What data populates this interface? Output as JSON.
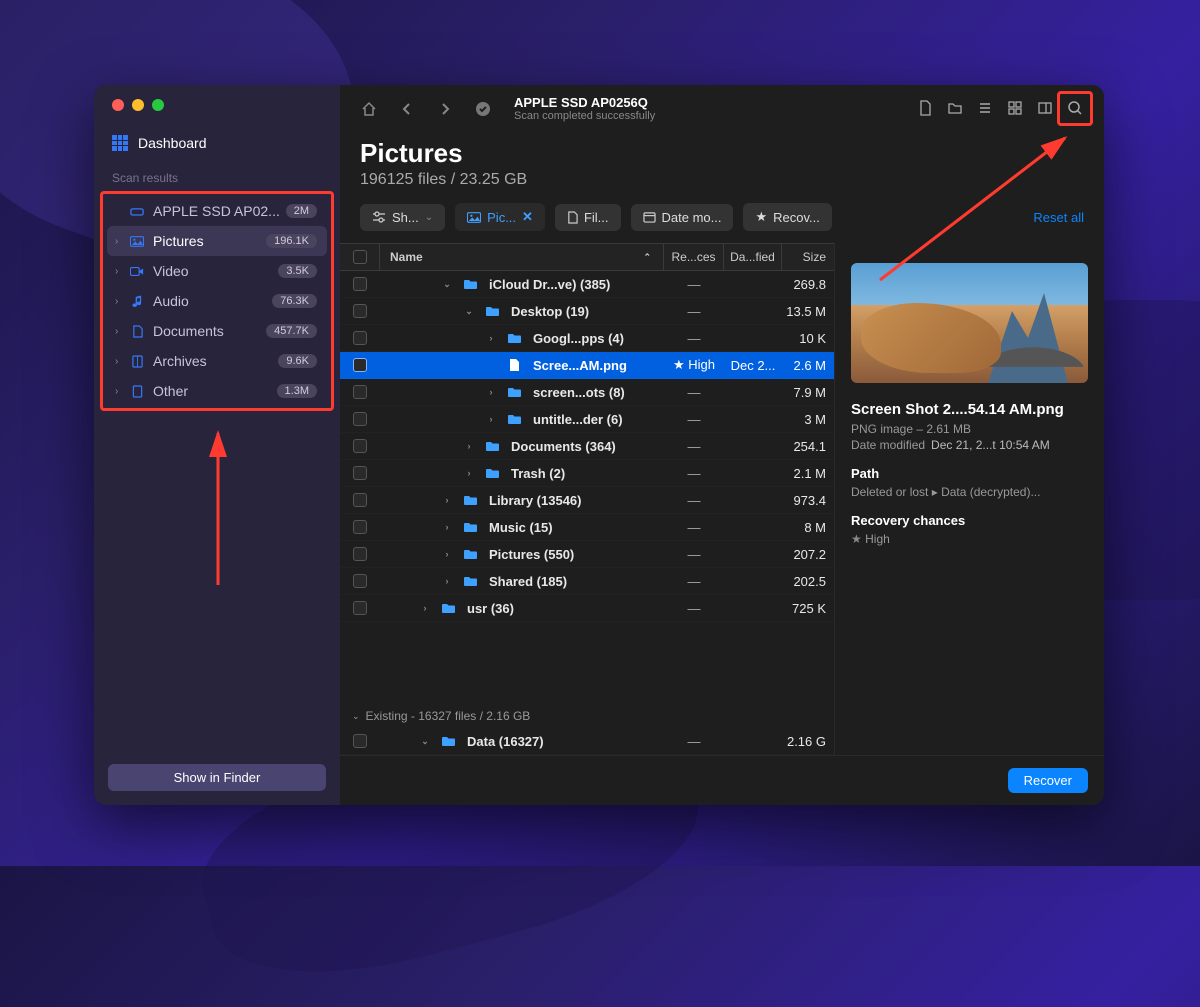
{
  "window": {
    "dashboard_label": "Dashboard",
    "scan_results_label": "Scan results",
    "show_in_finder": "Show in Finder"
  },
  "sidebar": {
    "items": [
      {
        "label": "APPLE SSD AP02...",
        "badge": "2M",
        "icon": "disk"
      },
      {
        "label": "Pictures",
        "badge": "196.1K",
        "icon": "pictures"
      },
      {
        "label": "Video",
        "badge": "3.5K",
        "icon": "video"
      },
      {
        "label": "Audio",
        "badge": "76.3K",
        "icon": "audio"
      },
      {
        "label": "Documents",
        "badge": "457.7K",
        "icon": "documents"
      },
      {
        "label": "Archives",
        "badge": "9.6K",
        "icon": "archives"
      },
      {
        "label": "Other",
        "badge": "1.3M",
        "icon": "other"
      }
    ]
  },
  "toolbar": {
    "title": "APPLE SSD AP0256Q",
    "subtitle": "Scan completed successfully"
  },
  "heading": {
    "title": "Pictures",
    "subtitle": "196125 files / 23.25 GB"
  },
  "filters": {
    "show": "Sh...",
    "pictures": "Pic...",
    "file": "Fil...",
    "date": "Date mo...",
    "recovery": "Recov...",
    "reset": "Reset all"
  },
  "columns": {
    "name": "Name",
    "recovery": "Re...ces",
    "date": "Da...fied",
    "size": "Size"
  },
  "rows": [
    {
      "indent": 2,
      "expander": "down",
      "icon": "folder",
      "name": "iCloud Dr...ve) (385)",
      "rec": "—",
      "date": "",
      "size": "269.8"
    },
    {
      "indent": 3,
      "expander": "down",
      "icon": "folder",
      "name": "Desktop (19)",
      "rec": "—",
      "date": "",
      "size": "13.5 M"
    },
    {
      "indent": 4,
      "expander": "right",
      "icon": "folder",
      "name": "Googl...pps (4)",
      "rec": "—",
      "date": "",
      "size": "10 K"
    },
    {
      "indent": 4,
      "expander": "",
      "icon": "file",
      "name": "Scree...AM.png",
      "rec": "★ High",
      "date": "Dec 2...",
      "size": "2.6 M",
      "selected": true
    },
    {
      "indent": 4,
      "expander": "right",
      "icon": "folder",
      "name": "screen...ots (8)",
      "rec": "—",
      "date": "",
      "size": "7.9 M"
    },
    {
      "indent": 4,
      "expander": "right",
      "icon": "folder",
      "name": "untitle...der (6)",
      "rec": "—",
      "date": "",
      "size": "3 M"
    },
    {
      "indent": 3,
      "expander": "right",
      "icon": "folder",
      "name": "Documents (364)",
      "rec": "—",
      "date": "",
      "size": "254.1"
    },
    {
      "indent": 3,
      "expander": "right",
      "icon": "folder",
      "name": "Trash (2)",
      "rec": "—",
      "date": "",
      "size": "2.1 M"
    },
    {
      "indent": 2,
      "expander": "right",
      "icon": "folder",
      "name": "Library (13546)",
      "rec": "—",
      "date": "",
      "size": "973.4"
    },
    {
      "indent": 2,
      "expander": "right",
      "icon": "folder",
      "name": "Music (15)",
      "rec": "—",
      "date": "",
      "size": "8 M"
    },
    {
      "indent": 2,
      "expander": "right",
      "icon": "folder",
      "name": "Pictures (550)",
      "rec": "—",
      "date": "",
      "size": "207.2"
    },
    {
      "indent": 2,
      "expander": "right",
      "icon": "folder",
      "name": "Shared (185)",
      "rec": "—",
      "date": "",
      "size": "202.5"
    },
    {
      "indent": 1,
      "expander": "right",
      "icon": "folder",
      "name": "usr (36)",
      "rec": "—",
      "date": "",
      "size": "725 K"
    }
  ],
  "existing_section": "Existing - 16327 files / 2.16 GB",
  "existing_row": {
    "indent": 1,
    "expander": "down",
    "icon": "folder",
    "name": "Data (16327)",
    "rec": "—",
    "date": "",
    "size": "2.16 G"
  },
  "preview": {
    "name": "Screen Shot 2....54.14 AM.png",
    "type_size": "PNG image – 2.61 MB",
    "date_label": "Date modified",
    "date_value": "Dec 21, 2...t 10:54 AM",
    "path_label": "Path",
    "path_value": "Deleted or lost ▸ Data (decrypted)...",
    "recovery_label": "Recovery chances",
    "recovery_value": "High"
  },
  "footer": {
    "recover": "Recover"
  }
}
